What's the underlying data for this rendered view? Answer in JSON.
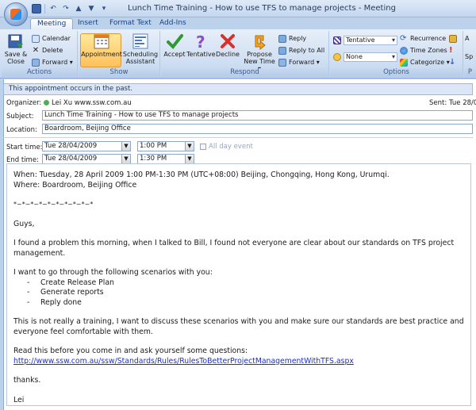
{
  "window": {
    "title": "Lunch Time Training - How to use TFS to manage projects - Meeting"
  },
  "tabs": [
    "Meeting",
    "Insert",
    "Format Text",
    "Add-Ins"
  ],
  "ribbon": {
    "actions": {
      "label": "Actions",
      "save_close": "Save &\nClose",
      "calendar": "Calendar",
      "delete": "Delete",
      "forward": "Forward ▾"
    },
    "show": {
      "label": "Show",
      "appointment": "Appointment",
      "scheduling": "Scheduling\nAssistant"
    },
    "respond": {
      "label": "Respond",
      "accept": "Accept",
      "tentative": "Tentative",
      "decline": "Decline",
      "propose": "Propose\nNew Time ▾",
      "reply": "Reply",
      "reply_all": "Reply to All",
      "forward": "Forward ▾"
    },
    "options": {
      "label": "Options",
      "show_as": "Tentative",
      "reminder": "None",
      "recurrence": "Recurrence",
      "time_zones": "Time Zones",
      "categorize": "Categorize ▾"
    },
    "partial_group": {
      "label": "P",
      "sp": "Sp"
    }
  },
  "infobar": "This appointment occurs in the past.",
  "form": {
    "organizer_label": "Organizer:",
    "organizer_value": "Lei Xu www.ssw.com.au",
    "sent_label": "Sent:",
    "sent_value": "Tue 28/0",
    "subject_label": "Subject:",
    "subject_value": "Lunch Time Training - How to use TFS to manage projects",
    "location_label": "Location:",
    "location_value": "Boardroom, Beijing Office",
    "start_label": "Start time:",
    "start_date": "Tue 28/04/2009",
    "start_time": "1:00 PM",
    "end_label": "End time:",
    "end_date": "Tue 28/04/2009",
    "end_time": "1:30 PM",
    "all_day": "All day event"
  },
  "body": {
    "when": "When: Tuesday, 28 April 2009 1:00 PM-1:30 PM (UTC+08:00) Beijing, Chongqing, Hong Kong, Urumqi.",
    "where": "Where: Boardroom, Beijing Office",
    "divider": "*~*~*~*~*~*~*~*~*~*",
    "greeting": "Guys,",
    "p1": "I found a problem this morning, when I talked to Bill, I found not everyone are clear about our standards on TFS project management.",
    "p2": "I want to go through the following scenarios with you:",
    "items": [
      "Create Release Plan",
      "Generate reports",
      "Reply done"
    ],
    "p3": "This is not really a training, I want to discuss these scenarios with you and make sure our standards are best practice and everyone feel comfortable with them.",
    "p4": "Read this before you come in and ask yourself some questions:",
    "link": "http://www.ssw.com.au/ssw/Standards/Rules/RulesToBetterProjectManagementWithTFS.aspx",
    "thanks": "thanks.",
    "signature": "Lei"
  }
}
